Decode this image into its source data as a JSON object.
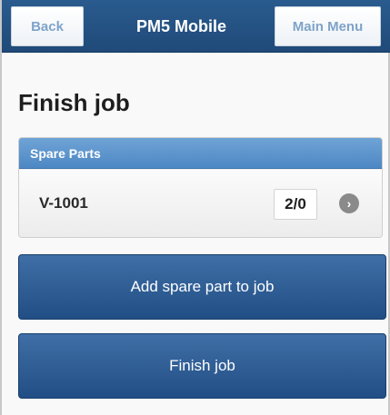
{
  "header": {
    "back_label": "Back",
    "title": "PM5 Mobile",
    "main_menu_label": "Main Menu"
  },
  "page": {
    "title": "Finish job"
  },
  "spare_parts": {
    "heading": "Spare Parts",
    "items": [
      {
        "name": "V-1001",
        "quantity": "2/0",
        "icon": "chevron-right-icon"
      }
    ]
  },
  "actions": {
    "add_spare_part_label": "Add spare part to job",
    "finish_job_label": "Finish job"
  },
  "colors": {
    "header_bg": "#2a5b8e",
    "panel_header_bg": "#5a93cc",
    "action_button_bg": "#2c5a92"
  }
}
